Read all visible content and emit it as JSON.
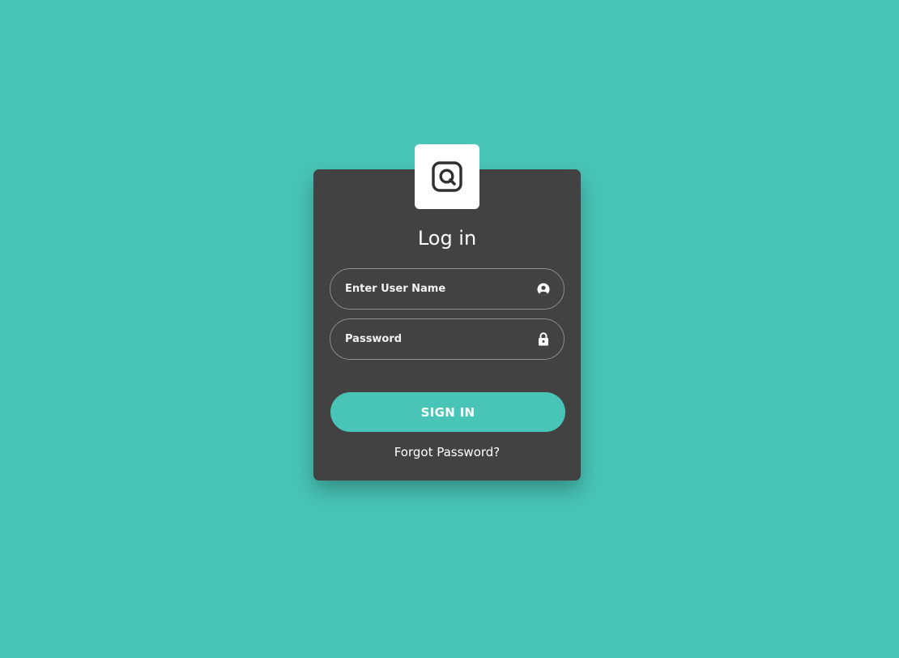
{
  "colors": {
    "background": "#48c5b6",
    "card": "#424242",
    "accent": "#48c5b6",
    "text": "#ffffff"
  },
  "logo": {
    "icon": "app-logo-icon"
  },
  "login": {
    "title": "Log in",
    "username": {
      "placeholder": "Enter User Name",
      "value": "",
      "icon": "user-circle-icon"
    },
    "password": {
      "placeholder": "Password",
      "value": "",
      "icon": "lock-icon"
    },
    "signin_label": "SIGN IN",
    "forgot_label": "Forgot Password?"
  }
}
